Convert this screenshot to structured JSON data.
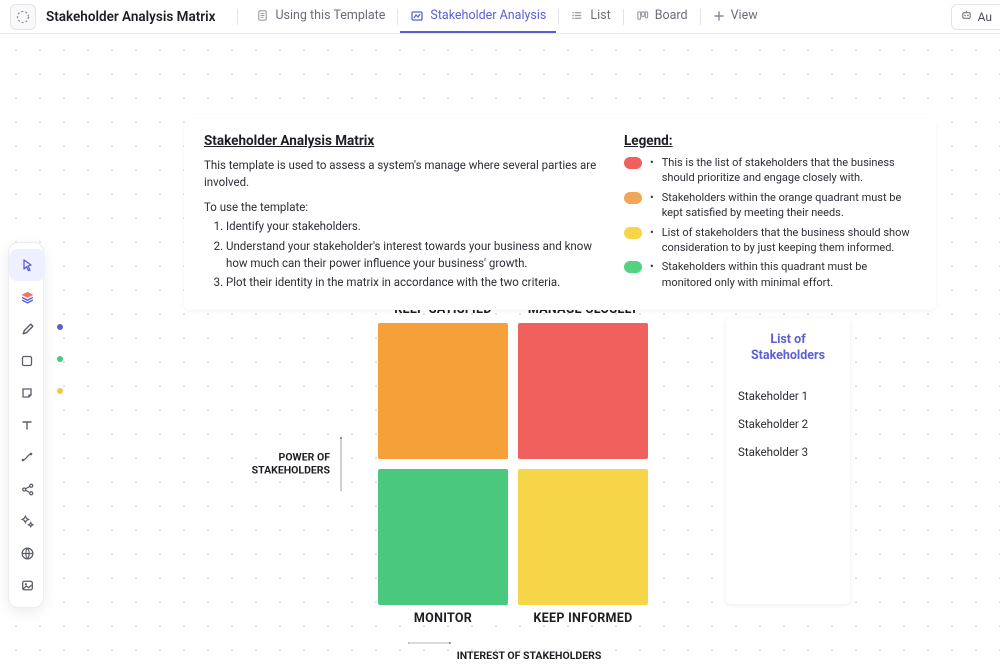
{
  "header": {
    "page_title": "Stakeholder Analysis Matrix",
    "tabs": [
      {
        "label": "Using this Template",
        "icon": "doc-icon",
        "active": false
      },
      {
        "label": "Stakeholder Analysis",
        "icon": "whiteboard-icon",
        "active": true
      },
      {
        "label": "List",
        "icon": "list-icon",
        "active": false
      },
      {
        "label": "Board",
        "icon": "board-icon",
        "active": false
      }
    ],
    "add_view_label": "View",
    "automation_label": "Au"
  },
  "left_toolbar": {
    "tools": [
      {
        "name": "cursor-tool",
        "active": true
      },
      {
        "name": "layers-tool",
        "marker_color": null
      },
      {
        "name": "pen-tool",
        "marker_color": "#5b5fd6"
      },
      {
        "name": "shape-tool",
        "marker_color": "#4ac97e"
      },
      {
        "name": "sticky-note-tool",
        "marker_color": "#f5c54a"
      },
      {
        "name": "text-tool"
      },
      {
        "name": "connector-tool"
      },
      {
        "name": "branch-tool"
      },
      {
        "name": "ai-sparkle-tool"
      },
      {
        "name": "web-tool"
      },
      {
        "name": "image-tool"
      }
    ]
  },
  "info_card": {
    "title": "Stakeholder Analysis Matrix",
    "description": "This template is used to assess a system's manage where several parties are involved.",
    "use_heading": "To use the template:",
    "steps": [
      "Identify your stakeholders.",
      "Understand your stakeholder's interest towards your business and know how much can their power influence your business' growth.",
      "Plot their identity in the matrix in accordance with the two criteria."
    ],
    "legend_title": "Legend:",
    "legend": [
      {
        "color": "#f0615d",
        "text": "This is the list of stakeholders that the business should prioritize and engage closely with."
      },
      {
        "color": "#f3a657",
        "text": "Stakeholders within the orange quadrant must be kept satisfied by meeting their needs."
      },
      {
        "color": "#f7d548",
        "text": "List of stakeholders that the business should show consideration to by just keeping them informed."
      },
      {
        "color": "#55d184",
        "text": "Stakeholders within this quadrant must be monitored only with minimal effort."
      }
    ]
  },
  "matrix": {
    "top_labels": [
      "KEEP SATISFIED",
      "MANAGE CLOSELY"
    ],
    "bottom_labels": [
      "MONITOR",
      "KEEP INFORMED"
    ],
    "quadrant_colors": {
      "top_left": "#f5a038",
      "top_right": "#f0615d",
      "bottom_left": "#4ac97e",
      "bottom_right": "#f7d548"
    },
    "y_axis_label": "POWER OF STAKEHOLDERS",
    "x_axis_label": "INTEREST OF STAKEHOLDERS"
  },
  "stakeholder_list": {
    "title": "List of Stakeholders",
    "items": [
      "Stakeholder 1",
      "Stakeholder 2",
      "Stakeholder 3"
    ]
  }
}
